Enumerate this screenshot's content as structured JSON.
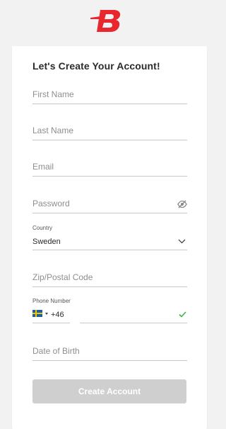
{
  "form": {
    "title": "Let's Create Your Account!",
    "first_name_placeholder": "First Name",
    "last_name_placeholder": "Last Name",
    "email_placeholder": "Email",
    "password_placeholder": "Password",
    "country_label": "Country",
    "country_value": "Sweden",
    "zip_placeholder": "Zip/Postal Code",
    "phone_label": "Phone Number",
    "phone_dial_code": "+46",
    "dob_placeholder": "Date of Birth",
    "submit_label": "Create Account"
  },
  "colors": {
    "brand_red": "#e8282d",
    "button_disabled": "#cfcfcf",
    "check_green": "#3bb54a"
  },
  "icons": {
    "logo": "brand-logo-b",
    "password_toggle": "eye-slash-icon",
    "country_dropdown": "chevron-down-icon",
    "phone_flag": "sweden-flag-icon",
    "phone_valid": "checkmark-icon"
  }
}
